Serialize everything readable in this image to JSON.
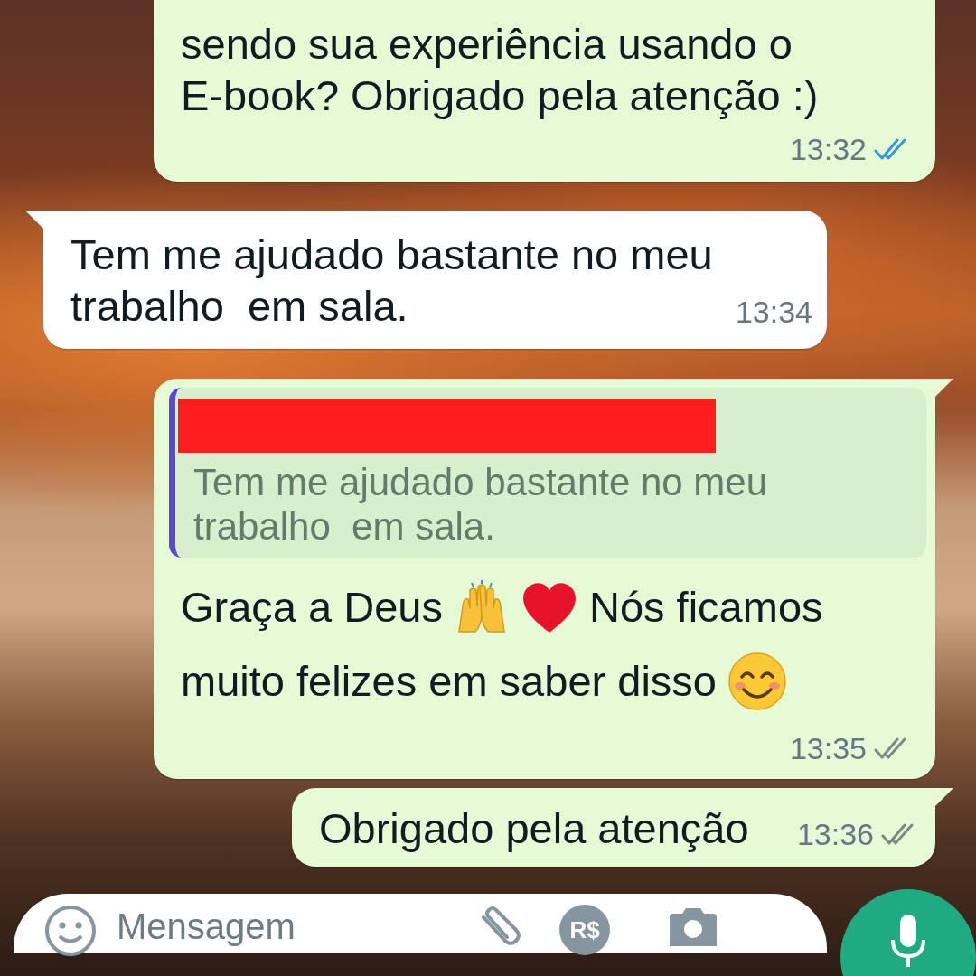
{
  "messages": [
    {
      "kind": "outgoing",
      "text": "sendo sua experiência usando o E-book? Obrigado pela atenção :)",
      "time": "13:32",
      "read": true
    },
    {
      "kind": "incoming",
      "text": "Tem me ajudado bastante no meu trabalho  em sala.",
      "time": "13:34"
    },
    {
      "kind": "outgoing",
      "quote": {
        "text": "Tem me ajudado bastante no meu trabalho  em sala."
      },
      "parts": [
        {
          "kind": "text",
          "text": "Graça a Deus"
        },
        {
          "kind": "hands"
        },
        {
          "kind": "heart"
        },
        {
          "kind": "text",
          "text": "Nós ficamos"
        },
        {
          "kind": "text",
          "text": "muito felizes em saber disso"
        },
        {
          "kind": "smile"
        }
      ],
      "time": "13:35",
      "read": false
    },
    {
      "kind": "outgoing",
      "text": "Obrigado pela atenção",
      "time": "13:36",
      "read": false
    }
  ],
  "composer": {
    "placeholder": "Mensagem",
    "payment_label": "R$"
  }
}
